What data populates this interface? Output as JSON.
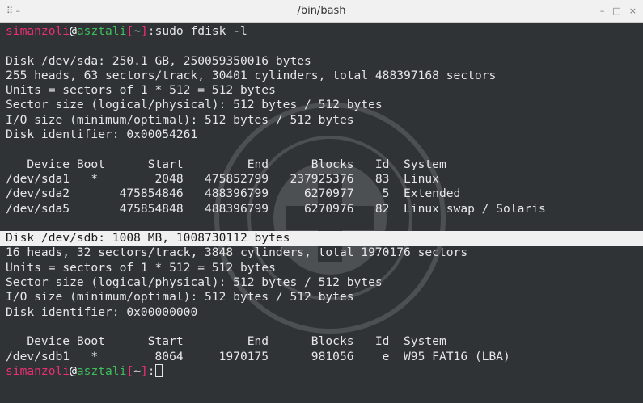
{
  "window": {
    "title": "/bin/bash",
    "menu_glyph": "⠿ –",
    "minimize": "–",
    "maximize": "□",
    "close": "×"
  },
  "prompt": {
    "user": "simanzoli",
    "at": "@",
    "host": "asztali",
    "open_bracket": "[",
    "path": "~",
    "close_bracket": "]",
    "colon": ":"
  },
  "command": "sudo fdisk -l",
  "disks": [
    {
      "lines": [
        "Disk /dev/sda: 250.1 GB, 250059350016 bytes",
        "255 heads, 63 sectors/track, 30401 cylinders, total 488397168 sectors",
        "Units = sectors of 1 * 512 = 512 bytes",
        "Sector size (logical/physical): 512 bytes / 512 bytes",
        "I/O size (minimum/optimal): 512 bytes / 512 bytes",
        "Disk identifier: 0x00054261"
      ],
      "table_header": "   Device Boot      Start         End      Blocks   Id  System",
      "rows": [
        "/dev/sda1   *        2048   475852799   237925376   83  Linux",
        "/dev/sda2       475854846   488396799     6270977    5  Extended",
        "/dev/sda5       475854848   488396799     6270976   82  Linux swap / Solaris"
      ]
    },
    {
      "highlight_line": "Disk /dev/sdb: 1008 MB, 1008730112 bytes",
      "lines": [
        "16 heads, 32 sectors/track, 3848 cylinders, total 1970176 sectors",
        "Units = sectors of 1 * 512 = 512 bytes",
        "Sector size (logical/physical): 512 bytes / 512 bytes",
        "I/O size (minimum/optimal): 512 bytes / 512 bytes",
        "Disk identifier: 0x00000000"
      ],
      "table_header": "   Device Boot      Start         End      Blocks   Id  System",
      "rows": [
        "/dev/sdb1   *        8064     1970175      981056    e  W95 FAT16 (LBA)"
      ]
    }
  ],
  "colors": {
    "background": "#2f3335",
    "text": "#e6e6e6",
    "user": "#ef2e74",
    "host": "#3fbf5c",
    "highlight_bg": "#f0f0f0"
  },
  "watermark_icon": "seal-icon"
}
